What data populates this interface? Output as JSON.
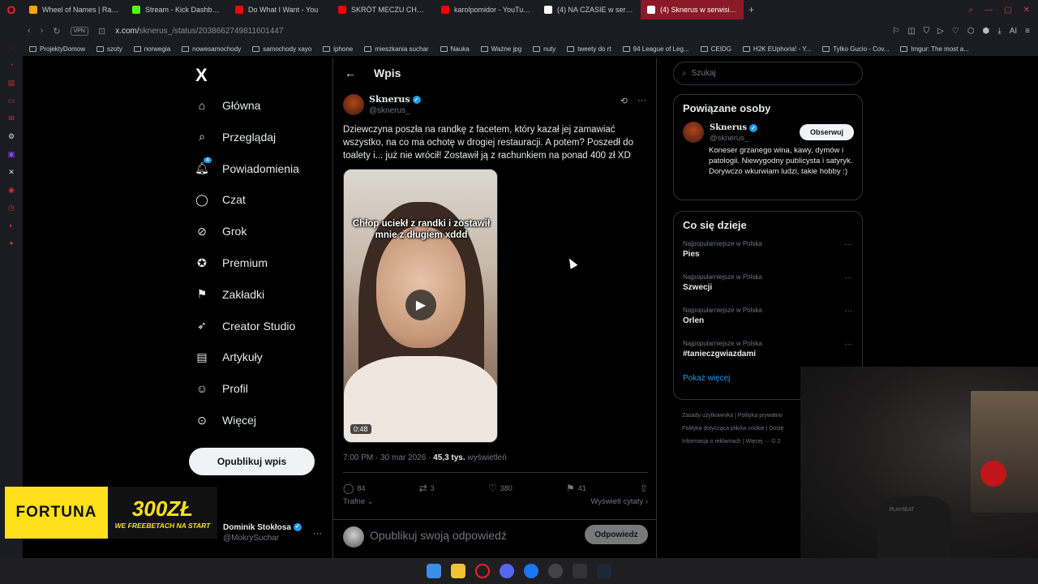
{
  "browser": {
    "tabs": [
      {
        "title": "Wheel of Names | Random",
        "color": "#ffa500"
      },
      {
        "title": "Stream - Kick Dashboard",
        "color": "#53fc18"
      },
      {
        "title": "Do What I Want - You",
        "color": "#ff0000"
      },
      {
        "title": "SKRÓT MECZU CHARYTA",
        "color": "#ff0000"
      },
      {
        "title": "karolpomidor - YouTube",
        "color": "#ff0000"
      },
      {
        "title": "(4) NA CZASIE w serwisie",
        "color": "#ffffff"
      },
      {
        "title": "(4) Sknerus w serwisie X",
        "color": "#ffffff",
        "active": true
      }
    ],
    "vpn_label": "VPN",
    "url_domain": "x.com/",
    "url_path": "sknerus_/status/2038662749811601447",
    "ai_label": "AI",
    "bookmarks": [
      "ProjektyDomow",
      "szoty",
      "norwegia",
      "nowesamochody",
      "samochody xayo",
      "iphone",
      "mieszkania suchar",
      "Nauka",
      "Ważne jpg",
      "nuty",
      "tweety do rt",
      "94 League of Leg...",
      "CEIDG",
      "H2K EUphoria! - Y...",
      "Tylko Gucio - Cov...",
      "Imgur: The most a..."
    ]
  },
  "x_nav": {
    "logo": "X",
    "items": [
      {
        "label": "Główna",
        "icon": "home-icon"
      },
      {
        "label": "Przeglądaj",
        "icon": "search-icon"
      },
      {
        "label": "Powiadomienia",
        "icon": "bell-icon",
        "badge": "4"
      },
      {
        "label": "Czat",
        "icon": "chat-icon"
      },
      {
        "label": "Grok",
        "icon": "grok-icon"
      },
      {
        "label": "Premium",
        "icon": "verified-icon"
      },
      {
        "label": "Zakładki",
        "icon": "bookmark-icon"
      },
      {
        "label": "Creator Studio",
        "icon": "rocket-icon"
      },
      {
        "label": "Artykuły",
        "icon": "article-icon"
      },
      {
        "label": "Profil",
        "icon": "person-icon"
      },
      {
        "label": "Więcej",
        "icon": "more-icon"
      }
    ],
    "post_button": "Opublikuj wpis",
    "account": {
      "name": "Dominik Stokłosa",
      "handle": "@MokrySuchar"
    }
  },
  "main": {
    "header": "Wpis",
    "author": {
      "name": "Sknerus",
      "handle": "@sknerus_"
    },
    "text": "Dziewczyna poszła na randkę z facetem, który kazał jej zamawiać wszystko, na co ma ochotę w drogiej restauracji. A potem? Poszedł do toalety i... już nie wrócił! Zostawił ją z rachunkiem na ponad 400 zł XD",
    "video": {
      "caption": "Chłop uciekł z randki i zostawił mnie z długiem xddd",
      "duration": "0:48"
    },
    "meta_time": "7:00 PM · 30 mar 2026 · ",
    "meta_views": "45,3 tys.",
    "meta_views_label": " wyświetleń",
    "stats": {
      "replies": "84",
      "reposts": "3",
      "likes": "380",
      "bookmarks": "41"
    },
    "relevance": "Trafne",
    "view_quotes": "Wyświetl cytaty ›",
    "reply_placeholder": "Opublikuj swoją odpowiedź",
    "reply_button": "Odpowiedz"
  },
  "right": {
    "search_placeholder": "Szukaj",
    "related_title": "Powiązane osoby",
    "related": {
      "name": "Sknerus",
      "handle": "@sknerus_",
      "follow": "Obserwuj",
      "bio": "Koneser grzanego wina, kawy, dymów i patologii. Niewygodny publicysta i satyryk. Dorywczo wkurwiam ludzi, takie hobby :)"
    },
    "trends_title": "Co się dzieje",
    "trends": [
      {
        "context": "Najpopularniejsze w Polska",
        "name": "Pies"
      },
      {
        "context": "Najpopularniejsze w Polska",
        "name": "Szwecji"
      },
      {
        "context": "Najpopularniejsze w Polska",
        "name": "Orlen"
      },
      {
        "context": "Najpopularniejsze w Polska",
        "name": "#tanieczgwiazdami"
      }
    ],
    "show_more": "Pokaż więcej",
    "footer_line1": "Zasady użytkownika | Polityka prywatno",
    "footer_line2": "Polityka dotycząca plików cookie | Dostę",
    "footer_line3": "Informacja o reklamach | Więcej ··· © 2"
  },
  "promo": {
    "brand": "FORTUNA",
    "amount": "300ZŁ",
    "subtitle": "WE FREEBETACH NA START"
  },
  "overlay": {
    "chair_text": "PLAYSEAT"
  }
}
